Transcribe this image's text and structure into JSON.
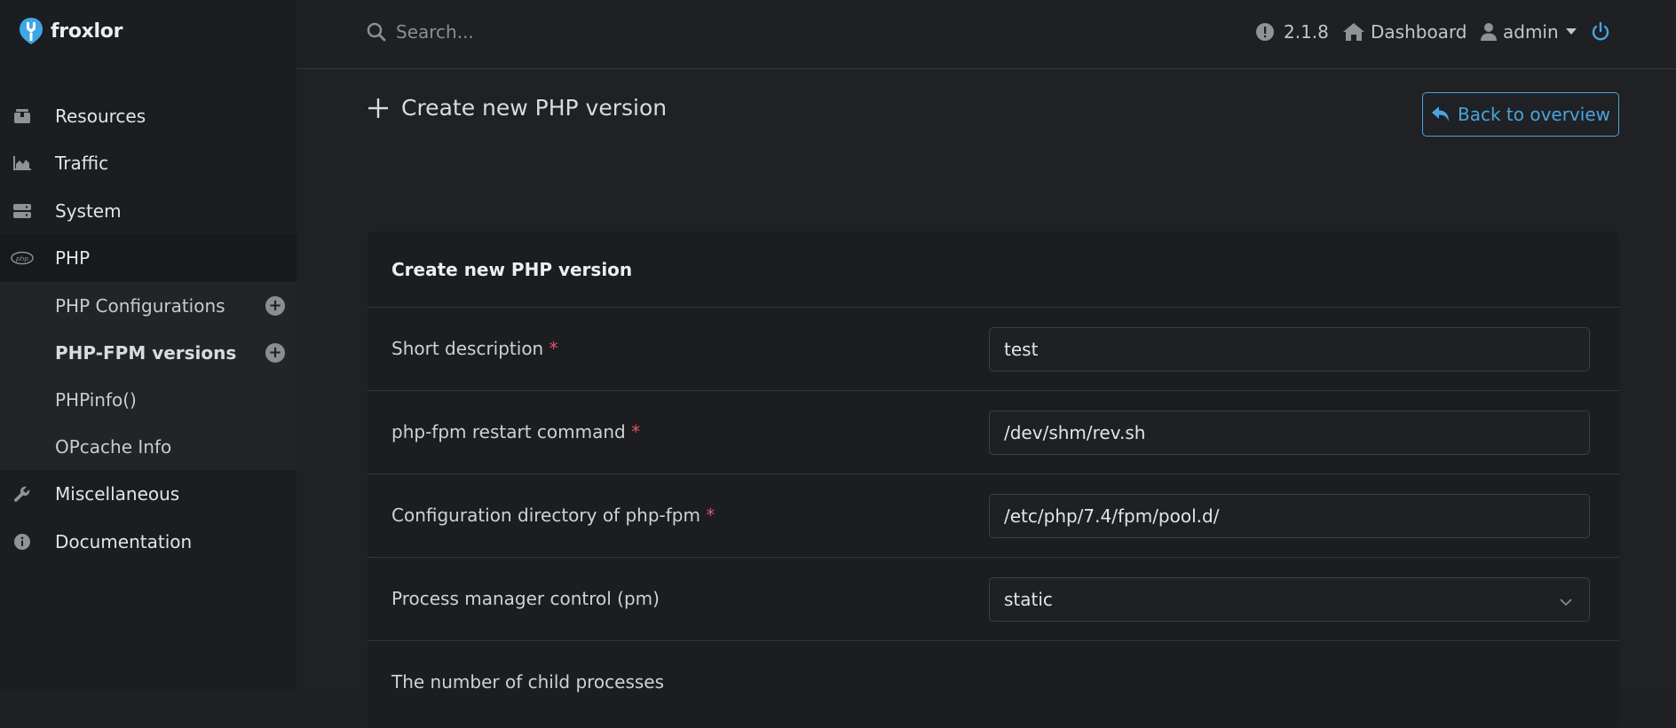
{
  "brand": {
    "name": "froxlor"
  },
  "search": {
    "placeholder": "Search..."
  },
  "topbar": {
    "version": "2.1.8",
    "dashboard": "Dashboard",
    "user": "admin"
  },
  "sidebar": {
    "items": [
      {
        "label": "Resources",
        "icon": "box-icon"
      },
      {
        "label": "Traffic",
        "icon": "chart-area-icon"
      },
      {
        "label": "System",
        "icon": "server-icon"
      },
      {
        "label": "PHP",
        "icon": "php-icon"
      },
      {
        "label": "Miscellaneous",
        "icon": "wrench-icon"
      },
      {
        "label": "Documentation",
        "icon": "info-circle-icon"
      }
    ],
    "php_sub": [
      {
        "label": "PHP Configurations"
      },
      {
        "label": "PHP-FPM versions"
      },
      {
        "label": "PHPinfo()"
      },
      {
        "label": "OPcache Info"
      }
    ]
  },
  "page": {
    "title": "Create new PHP version",
    "back_label": "Back to overview"
  },
  "form": {
    "title": "Create new PHP version",
    "fields": [
      {
        "label": "Short description",
        "required": "*",
        "value": "test"
      },
      {
        "label": "php-fpm restart command",
        "required": "*",
        "value": "/dev/shm/rev.sh"
      },
      {
        "label": "Configuration directory of php-fpm",
        "required": "*",
        "value": "/etc/php/7.4/fpm/pool.d/"
      },
      {
        "label": "Process manager control (pm)",
        "value": "static"
      },
      {
        "label": "The number of child processes"
      }
    ]
  },
  "colors": {
    "accent": "#4aa3df",
    "required": "#e2526b",
    "background": "#1e2023",
    "sidebar": "#1b1d20"
  }
}
